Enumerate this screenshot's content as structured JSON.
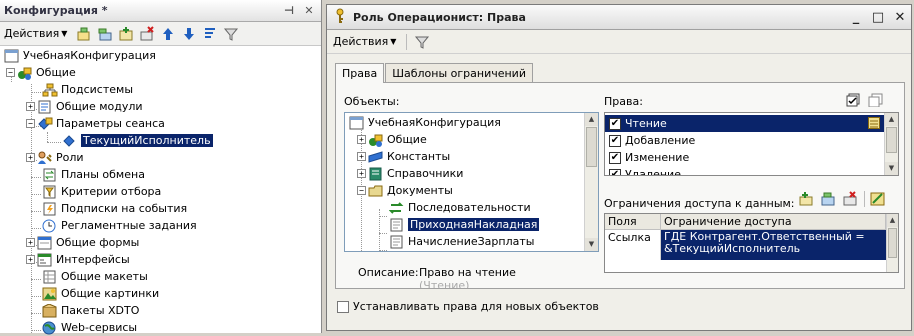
{
  "left_panel": {
    "title": "Конфигурация *",
    "pin_glyph": "⊣",
    "close_glyph": "✕",
    "actions_label": "Действия",
    "tree": [
      {
        "label": "УчебнаяКонфигурация",
        "icon": "config-icon"
      },
      {
        "label": "Общие",
        "icon": "common-icon"
      },
      {
        "label": "Подсистемы",
        "icon": "subsystems-icon"
      },
      {
        "label": "Общие модули",
        "icon": "module-icon"
      },
      {
        "label": "Параметры сеанса",
        "icon": "session-params-icon"
      },
      {
        "label": "ТекущийИсполнитель",
        "icon": "param-icon"
      },
      {
        "label": "Роли",
        "icon": "roles-icon"
      },
      {
        "label": "Планы обмена",
        "icon": "exchange-plans-icon"
      },
      {
        "label": "Критерии отбора",
        "icon": "filter-criteria-icon"
      },
      {
        "label": "Подписки на события",
        "icon": "event-subscriptions-icon"
      },
      {
        "label": "Регламентные задания",
        "icon": "scheduled-jobs-icon"
      },
      {
        "label": "Общие формы",
        "icon": "forms-icon"
      },
      {
        "label": "Интерфейсы",
        "icon": "interfaces-icon"
      },
      {
        "label": "Общие макеты",
        "icon": "templates-icon"
      },
      {
        "label": "Общие картинки",
        "icon": "pictures-icon"
      },
      {
        "label": "Пакеты XDTO",
        "icon": "xdto-icon"
      },
      {
        "label": "Web-сервисы",
        "icon": "web-services-icon"
      }
    ]
  },
  "window": {
    "title": "Роль Операционист: Права",
    "min_glyph": "_",
    "max_glyph": "□",
    "close_glyph": "✕",
    "actions_label": "Действия",
    "tabs": [
      "Права",
      "Шаблоны ограничений"
    ],
    "objects_label": "Объекты:",
    "objects_tree": [
      {
        "label": "УчебнаяКонфигурация"
      },
      {
        "label": "Общие"
      },
      {
        "label": "Константы"
      },
      {
        "label": "Справочники"
      },
      {
        "label": "Документы"
      },
      {
        "label": "Последовательности"
      },
      {
        "label": "ПриходнаяНакладная"
      },
      {
        "label": "НачислениеЗарплаты"
      }
    ],
    "description_label": "Описание:",
    "description_value": "Право на чтение",
    "description_value2": "(Чтение)",
    "rights_label": "Права:",
    "rights": [
      {
        "label": "Чтение",
        "checked": true
      },
      {
        "label": "Добавление",
        "checked": true
      },
      {
        "label": "Изменение",
        "checked": true
      },
      {
        "label": "Удаление",
        "checked": true
      }
    ],
    "restrictions_label": "Ограничения доступа к данным:",
    "grid_headers": [
      "Поля",
      "Ограничение доступа"
    ],
    "grid_row": {
      "field": "Ссылка",
      "restriction_line1": "ГДЕ Контрагент.Ответственный =",
      "restriction_line2": "&ТекущийИсполнитель"
    },
    "new_objects_label": "Устанавливать права для новых объектов"
  },
  "colors": {
    "selection": "#0a246a",
    "window_bg": "#f0efe9"
  }
}
